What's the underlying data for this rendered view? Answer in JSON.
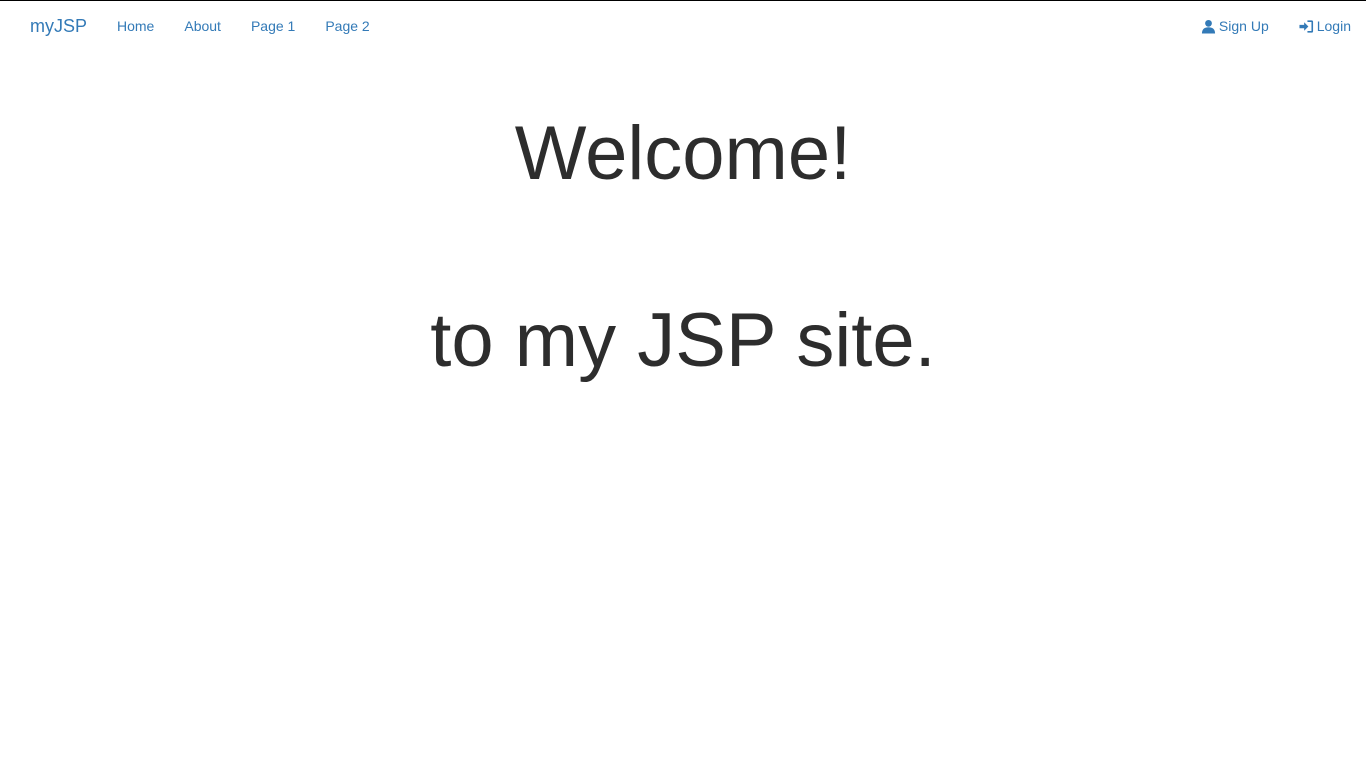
{
  "navbar": {
    "brand": "myJSP",
    "left_links": [
      {
        "label": "Home"
      },
      {
        "label": "About"
      },
      {
        "label": "Page 1"
      },
      {
        "label": "Page 2"
      }
    ],
    "right_links": [
      {
        "label": "Sign Up",
        "icon": "user-icon"
      },
      {
        "label": "Login",
        "icon": "login-icon"
      }
    ]
  },
  "main": {
    "heading": "Welcome!",
    "subheading": "to my JSP site."
  },
  "colors": {
    "link": "#337ab7",
    "text": "#2d2d2d",
    "background": "#ffffff"
  }
}
